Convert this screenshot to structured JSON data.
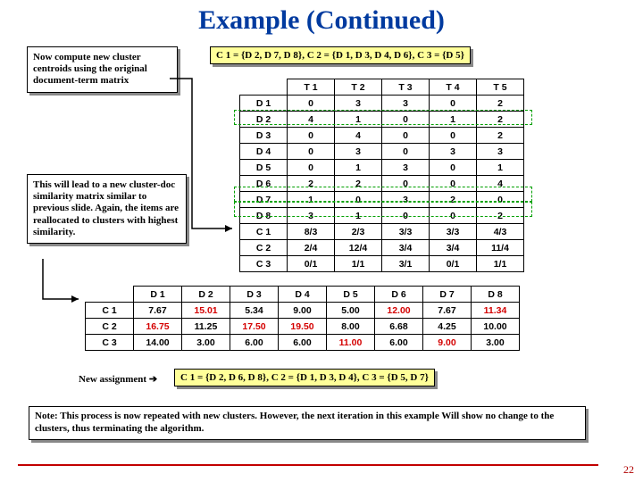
{
  "title": "Example (Continued)",
  "callout1": "Now compute new cluster centroids using the original document-term matrix",
  "callout2": "This will lead to a new cluster-doc similarity matrix similar to previous slide. Again, the items are reallocated to clusters with highest similarity.",
  "clusters_top": "C 1 = {D 2, D 7, D 8},    C 2 = {D 1, D 3, D 4, D 6},    C 3 = {D 5}",
  "clusters_bottom": "C 1 = {D 2, D 6, D 8},    C 2 = {D 1, D 3, D 4},    C 3 = {D 5, D 7}",
  "new_assignment_label": "New assignment ",
  "note_bottom": "Note: This process is now repeated with new clusters. However, the next iteration in this example Will show no change to the clusters, thus terminating the algorithm.",
  "slide_number": "22",
  "main_table": {
    "col_headers": [
      "T 1",
      "T 2",
      "T 3",
      "T 4",
      "T 5"
    ],
    "d_rows": [
      {
        "h": "D 1",
        "v": [
          "0",
          "3",
          "3",
          "0",
          "2"
        ]
      },
      {
        "h": "D 2",
        "v": [
          "4",
          "1",
          "0",
          "1",
          "2"
        ]
      },
      {
        "h": "D 3",
        "v": [
          "0",
          "4",
          "0",
          "0",
          "2"
        ]
      },
      {
        "h": "D 4",
        "v": [
          "0",
          "3",
          "0",
          "3",
          "3"
        ]
      },
      {
        "h": "D 5",
        "v": [
          "0",
          "1",
          "3",
          "0",
          "1"
        ]
      },
      {
        "h": "D 6",
        "v": [
          "2",
          "2",
          "0",
          "0",
          "4"
        ]
      },
      {
        "h": "D 7",
        "v": [
          "1",
          "0",
          "3",
          "2",
          "0"
        ]
      },
      {
        "h": "D 8",
        "v": [
          "3",
          "1",
          "0",
          "0",
          "2"
        ]
      }
    ],
    "c_rows": [
      {
        "h": "C 1",
        "v": [
          "8/3",
          "2/3",
          "3/3",
          "3/3",
          "4/3"
        ]
      },
      {
        "h": "C 2",
        "v": [
          "2/4",
          "12/4",
          "3/4",
          "3/4",
          "11/4"
        ]
      },
      {
        "h": "C 3",
        "v": [
          "0/1",
          "1/1",
          "3/1",
          "0/1",
          "1/1"
        ]
      }
    ]
  },
  "sim_table": {
    "col_headers": [
      "D 1",
      "D 2",
      "D 3",
      "D 4",
      "D 5",
      "D 6",
      "D 7",
      "D 8"
    ],
    "rows": [
      {
        "h": "C 1",
        "v": [
          {
            "t": "7.67",
            "hi": false
          },
          {
            "t": "15.01",
            "hi": true
          },
          {
            "t": "5.34",
            "hi": false
          },
          {
            "t": "9.00",
            "hi": false
          },
          {
            "t": "5.00",
            "hi": false
          },
          {
            "t": "12.00",
            "hi": true
          },
          {
            "t": "7.67",
            "hi": false
          },
          {
            "t": "11.34",
            "hi": true
          }
        ]
      },
      {
        "h": "C 2",
        "v": [
          {
            "t": "16.75",
            "hi": true
          },
          {
            "t": "11.25",
            "hi": false
          },
          {
            "t": "17.50",
            "hi": true
          },
          {
            "t": "19.50",
            "hi": true
          },
          {
            "t": "8.00",
            "hi": false
          },
          {
            "t": "6.68",
            "hi": false
          },
          {
            "t": "4.25",
            "hi": false
          },
          {
            "t": "10.00",
            "hi": false
          }
        ]
      },
      {
        "h": "C 3",
        "v": [
          {
            "t": "14.00",
            "hi": false
          },
          {
            "t": "3.00",
            "hi": false
          },
          {
            "t": "6.00",
            "hi": false
          },
          {
            "t": "6.00",
            "hi": false
          },
          {
            "t": "11.00",
            "hi": true
          },
          {
            "t": "6.00",
            "hi": false
          },
          {
            "t": "9.00",
            "hi": true
          },
          {
            "t": "3.00",
            "hi": false
          }
        ]
      }
    ]
  }
}
